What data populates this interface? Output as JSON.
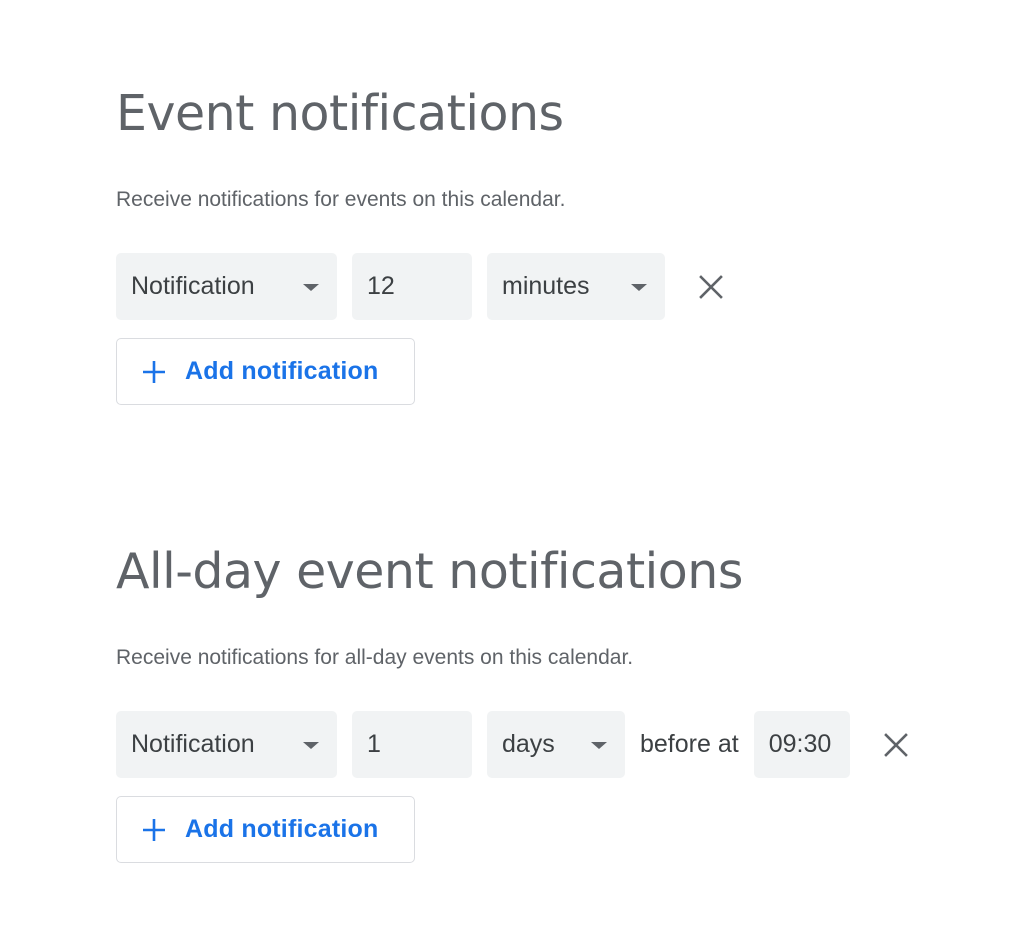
{
  "event_notifications": {
    "title": "Event notifications",
    "description": "Receive notifications for events on this calendar.",
    "rows": [
      {
        "type": "Notification",
        "amount": "12",
        "unit": "minutes"
      }
    ],
    "add_label": "Add notification"
  },
  "all_day_notifications": {
    "title": "All-day event notifications",
    "description": "Receive notifications for all-day events on this calendar.",
    "rows": [
      {
        "type": "Notification",
        "amount": "1",
        "unit": "days",
        "before_at_label": "before at",
        "time": "09:30"
      }
    ],
    "add_label": "Add notification"
  },
  "icons": {
    "dropdown": "chevron-down-icon",
    "remove": "close-icon",
    "add": "plus-icon"
  },
  "colors": {
    "accent": "#1a73e8",
    "field_bg": "#f1f3f4",
    "heading": "#5f6368",
    "text": "#3c4043",
    "border": "#dadce0"
  }
}
